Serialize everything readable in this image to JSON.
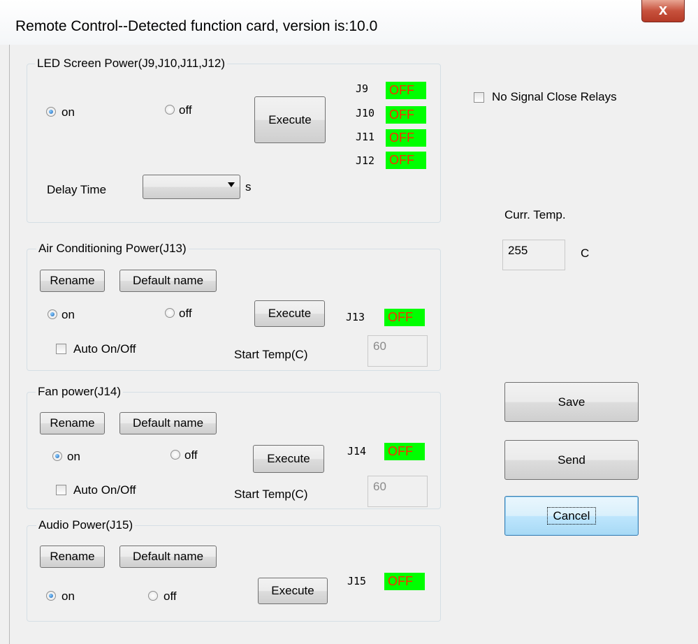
{
  "window": {
    "title": "Remote Control--Detected function card, version is:10.0",
    "close_glyph": "x"
  },
  "common": {
    "on": "on",
    "off": "off",
    "execute": "Execute",
    "rename": "Rename",
    "default_name": "Default name",
    "status_off": "OFF",
    "auto": "Auto On/Off",
    "start_temp": "Start Temp(C)"
  },
  "led": {
    "legend": "LED Screen Power(J9,J10,J11,J12)",
    "relays": [
      "J9",
      "J10",
      "J11",
      "J12"
    ],
    "delay_label": "Delay Time",
    "delay_value": "",
    "delay_unit": "s"
  },
  "ac": {
    "legend": "Air Conditioning Power(J13)",
    "relay": "J13",
    "start_temp_value": "60"
  },
  "fan": {
    "legend": "Fan power(J14)",
    "relay": "J14",
    "start_temp_value": "60"
  },
  "audio": {
    "legend": "Audio Power(J15)",
    "relay": "J15"
  },
  "side": {
    "no_signal": "No Signal Close Relays",
    "curr_temp_label": "Curr. Temp.",
    "curr_temp_value": "255",
    "temp_unit": "C",
    "save": "Save",
    "send": "Send",
    "cancel": "Cancel"
  },
  "colors": {
    "status_bg": "#00ff00",
    "status_text": "#ff2a00",
    "close_button": "#c7523d"
  }
}
